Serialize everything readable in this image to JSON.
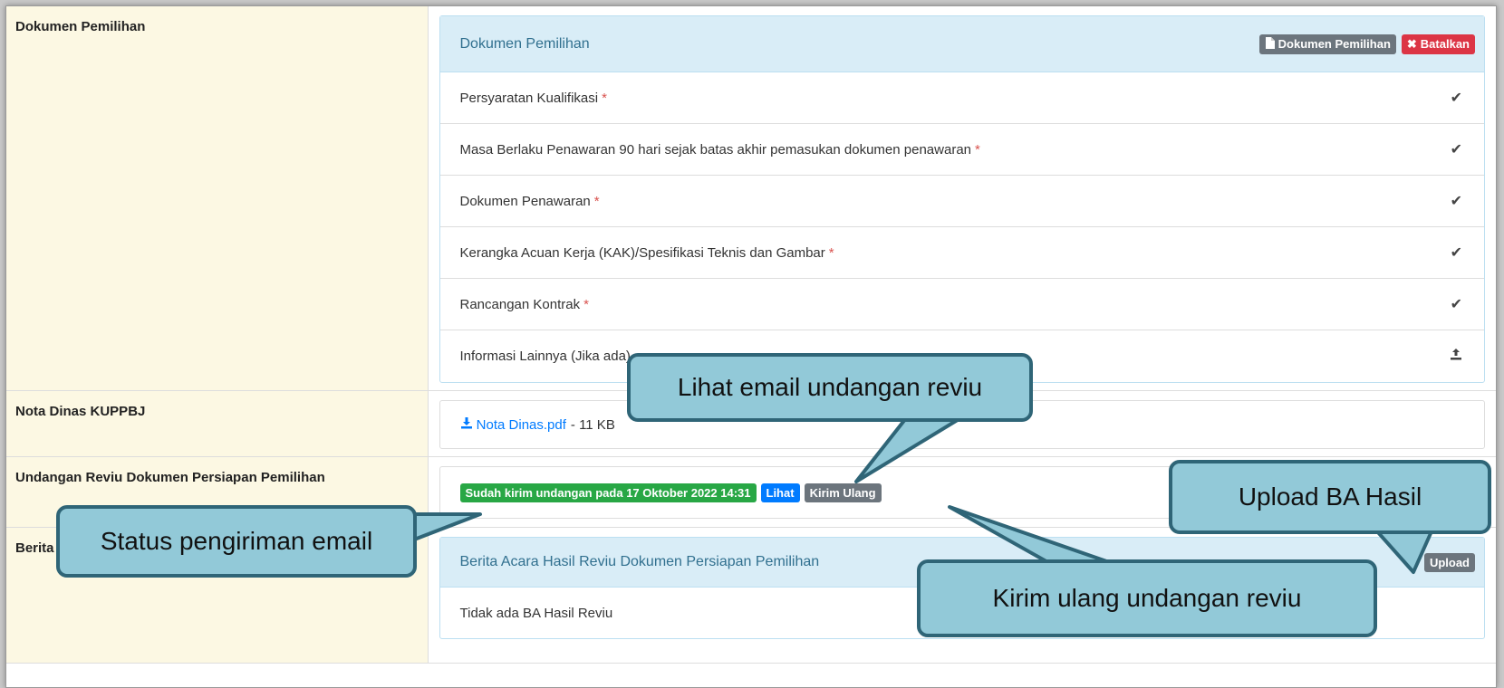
{
  "rows": {
    "dokumen": {
      "label": "Dokumen Pemilihan",
      "panel_title": "Dokumen Pemilihan",
      "btn_dokumen": "Dokumen Pemilihan",
      "btn_batalkan": "Batalkan",
      "items": [
        {
          "label": "Persyaratan Kualifikasi",
          "required": "*",
          "icon": "check-icon"
        },
        {
          "label": "Masa Berlaku Penawaran 90 hari sejak batas akhir pemasukan dokumen penawaran",
          "required": "*",
          "icon": "check-icon"
        },
        {
          "label": "Dokumen Penawaran",
          "required": "*",
          "icon": "check-icon"
        },
        {
          "label": "Kerangka Acuan Kerja (KAK)/Spesifikasi Teknis dan Gambar",
          "required": "*",
          "icon": "check-icon"
        },
        {
          "label": "Rancangan Kontrak",
          "required": "*",
          "icon": "check-icon"
        },
        {
          "label": "Informasi Lainnya (Jika ada)",
          "required": "",
          "icon": "upload-icon"
        }
      ]
    },
    "nota": {
      "label": "Nota Dinas KUPPBJ",
      "file_name": "Nota Dinas.pdf",
      "file_size": "- 11 KB"
    },
    "undangan": {
      "label": "Undangan Reviu Dokumen Persiapan Pemilihan",
      "status": "Sudah kirim undangan pada 17 Oktober 2022 14:31",
      "btn_lihat": "Lihat",
      "btn_kirim_ulang": "Kirim Ulang"
    },
    "berita": {
      "label": "Berita Acara Hasil Reviu Dokumen Persiapan Pemilihan",
      "panel_title": "Berita Acara Hasil Reviu Dokumen Persiapan Pemilihan",
      "btn_upload": "Upload",
      "empty_text": "Tidak ada BA Hasil Reviu"
    }
  },
  "callouts": {
    "lihat_email": "Lihat email undangan reviu",
    "status_email": "Status pengiriman email",
    "upload_ba": "Upload BA Hasil",
    "kirim_ulang": "Kirim ulang undangan reviu"
  },
  "colors": {
    "label_bg": "#fcf8e3",
    "panel_heading_bg": "#d9edf7",
    "callout_fill": "#92c9d8",
    "callout_border": "#2f6577"
  }
}
